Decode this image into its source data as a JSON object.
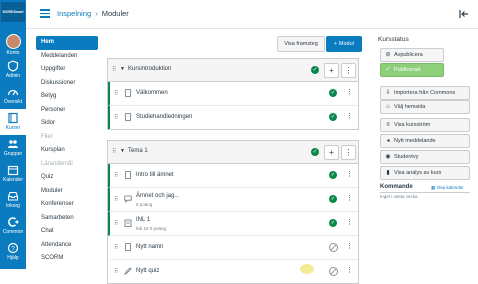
{
  "global_nav": {
    "logo": "WORDSmart",
    "items": [
      {
        "label": "Konto",
        "icon": "avatar"
      },
      {
        "label": "Admin",
        "icon": "shield-icon"
      },
      {
        "label": "Översikt",
        "icon": "dashboard-icon"
      },
      {
        "label": "Kurser",
        "icon": "book-icon"
      },
      {
        "label": "Grupper",
        "icon": "groups-icon"
      },
      {
        "label": "Kalender",
        "icon": "calendar-icon"
      },
      {
        "label": "Inkorg",
        "icon": "inbox-icon"
      },
      {
        "label": "Common",
        "icon": "commons-icon"
      },
      {
        "label": "Hjälp",
        "icon": "help-icon"
      }
    ],
    "active_index": 3
  },
  "breadcrumb": {
    "course": "Inspelning",
    "page": "Moduler"
  },
  "course_nav": [
    {
      "label": "Hem",
      "state": "active"
    },
    {
      "label": "Meddelanden",
      "state": "normal"
    },
    {
      "label": "Uppgifter",
      "state": "normal"
    },
    {
      "label": "Diskussioner",
      "state": "normal"
    },
    {
      "label": "Betyg",
      "state": "normal"
    },
    {
      "label": "Personer",
      "state": "normal"
    },
    {
      "label": "Sidor",
      "state": "normal"
    },
    {
      "label": "Filer",
      "state": "hidden"
    },
    {
      "label": "Kursplan",
      "state": "normal"
    },
    {
      "label": "Lärandemål",
      "state": "hidden"
    },
    {
      "label": "Quiz",
      "state": "normal"
    },
    {
      "label": "Moduler",
      "state": "normal"
    },
    {
      "label": "Konferenser",
      "state": "normal"
    },
    {
      "label": "Samarbeten",
      "state": "normal"
    },
    {
      "label": "Chat",
      "state": "normal"
    },
    {
      "label": "Attendance",
      "state": "normal"
    },
    {
      "label": "SCORM",
      "state": "normal"
    }
  ],
  "toolbar": {
    "progress_label": "Visa framsteg",
    "add_module_label": "+ Modul"
  },
  "modules": [
    {
      "title": "Kursintroduktion",
      "items": [
        {
          "title": "Välkommen",
          "sub": "",
          "icon": "page-icon",
          "published": true
        },
        {
          "title": "Studiehandledningen",
          "sub": "",
          "icon": "page-icon",
          "published": true
        }
      ]
    },
    {
      "title": "Tema 1",
      "items": [
        {
          "title": "Intro till ämnet",
          "sub": "",
          "icon": "page-icon",
          "published": true
        },
        {
          "title": "Ämnet och jag...",
          "sub": "5 poäng",
          "icon": "discussion-icon",
          "published": true
        },
        {
          "title": "INL 1",
          "sub": "feb 16   0 poäng",
          "icon": "assignment-icon",
          "published": true
        },
        {
          "title": "Nytt namn",
          "sub": "",
          "icon": "page-icon",
          "published": false
        },
        {
          "title": "Nytt quiz",
          "sub": "",
          "icon": "quiz-icon",
          "published": false
        }
      ]
    }
  ],
  "sidebar": {
    "status_heading": "Kursstatus",
    "unpublish_label": "Avpublicera",
    "published_label": "Publicerad",
    "actions": [
      {
        "label": "Importera från Commons",
        "icon": "import-icon"
      },
      {
        "label": "Välj hemsida",
        "icon": "home-icon"
      },
      {
        "label": "Visa kursström",
        "icon": "stream-icon"
      },
      {
        "label": "Nytt meddelande",
        "icon": "announcement-icon"
      },
      {
        "label": "Studentvy",
        "icon": "student-view-icon"
      },
      {
        "label": "Visa analys av kurs",
        "icon": "analytics-icon"
      }
    ],
    "upcoming_heading": "Kommande",
    "upcoming_link": "Visa kalender",
    "upcoming_empty": "Inget i nästa vecka"
  }
}
